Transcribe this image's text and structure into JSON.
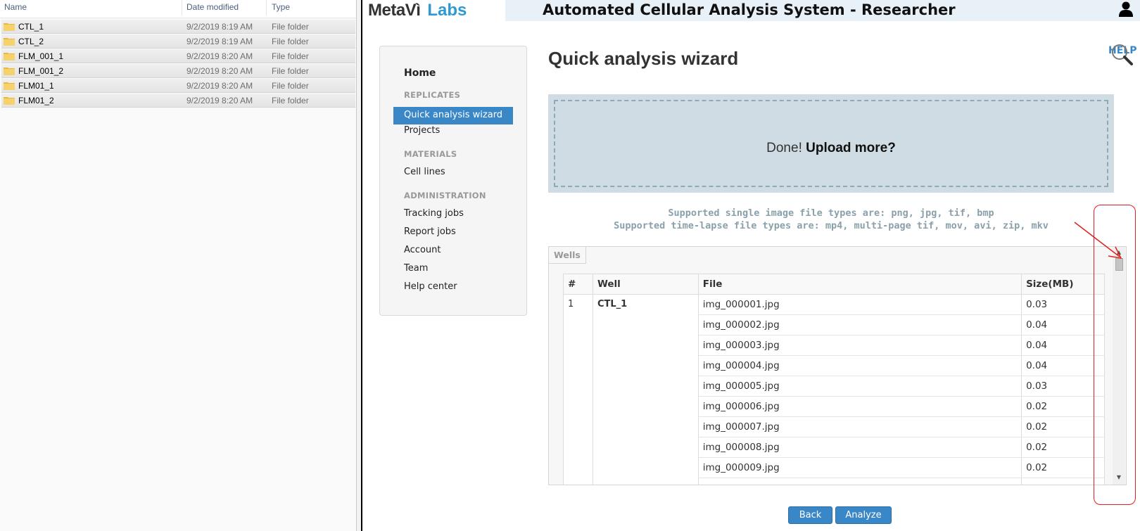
{
  "explorer": {
    "columns": [
      "Name",
      "Date modified",
      "Type"
    ],
    "rows": [
      {
        "name": "CTL_1",
        "date": "9/2/2019 8:19 AM",
        "type": "File folder"
      },
      {
        "name": "CTL_2",
        "date": "9/2/2019 8:19 AM",
        "type": "File folder"
      },
      {
        "name": "FLM_001_1",
        "date": "9/2/2019 8:20 AM",
        "type": "File folder"
      },
      {
        "name": "FLM_001_2",
        "date": "9/2/2019 8:20 AM",
        "type": "File folder"
      },
      {
        "name": "FLM01_1",
        "date": "9/2/2019 8:20 AM",
        "type": "File folder"
      },
      {
        "name": "FLM01_2",
        "date": "9/2/2019 8:20 AM",
        "type": "File folder"
      }
    ]
  },
  "header": {
    "logo_meta": "MetaVì",
    "logo_labs": "Labs",
    "title": "Automated Cellular Analysis System - Researcher",
    "user_icon": "user-icon"
  },
  "sidebar": {
    "home": "Home",
    "sections": [
      {
        "title": "REPLICATES",
        "items": [
          "Quick analysis wizard",
          "Projects"
        ]
      },
      {
        "title": "MATERIALS",
        "items": [
          "Cell lines"
        ]
      },
      {
        "title": "ADMINISTRATION",
        "items": [
          "Tracking jobs",
          "Report jobs",
          "Account",
          "Team",
          "Help center"
        ]
      }
    ],
    "active": "Quick analysis wizard"
  },
  "main": {
    "title": "Quick analysis wizard",
    "help": "HELP",
    "dropzone_done": "Done!",
    "dropzone_more": "Upload more?",
    "support_single": "Supported single image file types are: png, jpg, tif, bmp",
    "support_timelapse": "Supported time-lapse file types are: mp4, multi-page tif, mov, avi, zip, mkv",
    "wells_legend": "Wells",
    "table_headers": [
      "#",
      "Well",
      "File",
      "Size(MB)"
    ],
    "well_number": "1",
    "well_name": "CTL_1",
    "files": [
      {
        "file": "img_000001.jpg",
        "size": "0.03"
      },
      {
        "file": "img_000002.jpg",
        "size": "0.04"
      },
      {
        "file": "img_000003.jpg",
        "size": "0.04"
      },
      {
        "file": "img_000004.jpg",
        "size": "0.04"
      },
      {
        "file": "img_000005.jpg",
        "size": "0.03"
      },
      {
        "file": "img_000006.jpg",
        "size": "0.02"
      },
      {
        "file": "img_000007.jpg",
        "size": "0.02"
      },
      {
        "file": "img_000008.jpg",
        "size": "0.02"
      },
      {
        "file": "img_000009.jpg",
        "size": "0.02"
      }
    ],
    "back_label": "Back",
    "analyze_label": "Analyze"
  },
  "colors": {
    "accent": "#3a87c8",
    "logo_labs": "#2f9ad0",
    "annotation": "#e02020"
  }
}
